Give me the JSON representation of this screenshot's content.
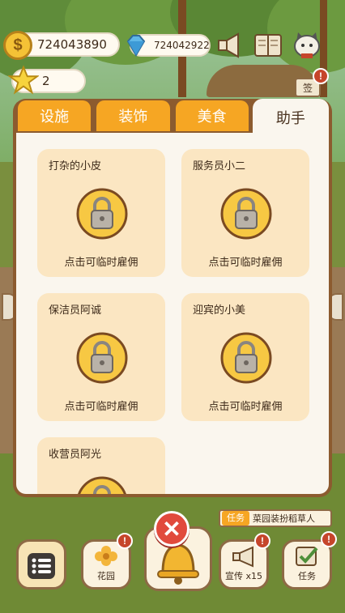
{
  "hud": {
    "gold": "724043890",
    "gems": "724042922",
    "stars": "2",
    "sign_label": "签",
    "alert_mark": "!"
  },
  "tabs": [
    {
      "label": "设施",
      "active": false
    },
    {
      "label": "装饰",
      "active": false
    },
    {
      "label": "美食",
      "active": false
    },
    {
      "label": "助手",
      "active": true
    }
  ],
  "helpers": [
    {
      "name": "打杂的小皮",
      "action": "点击可临时雇佣",
      "icon": "locked-helper-icon"
    },
    {
      "name": "服务员小二",
      "action": "点击可临时雇佣",
      "icon": "locked-helper-icon"
    },
    {
      "name": "保洁员阿诚",
      "action": "点击可临时雇佣",
      "icon": "locked-helper-icon"
    },
    {
      "name": "迎宾的小美",
      "action": "点击可临时雇佣",
      "icon": "locked-helper-icon"
    },
    {
      "name": "收营员阿光",
      "action": "",
      "icon": "locked-helper-icon"
    }
  ],
  "task_banner": {
    "tag": "任务",
    "text": "菜园装扮稻草人"
  },
  "bottom_bar": {
    "garden": "花园",
    "promo": "宣传 x15",
    "task": "任务",
    "close": "✕"
  },
  "colors": {
    "tab_orange": "#f6a623",
    "panel_brown": "#8c5b2f",
    "card_bg": "#fbe6c2",
    "lock_yellow": "#f7c843",
    "close_red": "#e14a3d"
  }
}
